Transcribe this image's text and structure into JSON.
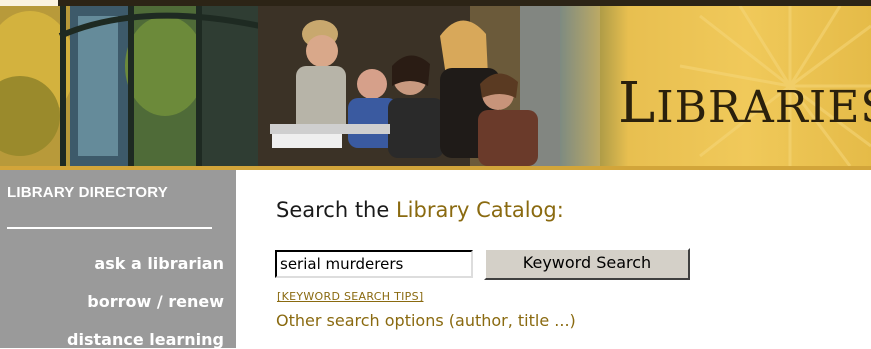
{
  "header": {
    "brand_first": "L",
    "brand_rest": "IBRARIES"
  },
  "sidebar": {
    "heading": "LIBRARY DIRECTORY",
    "links": [
      "ask a librarian",
      "borrow / renew",
      "distance learning"
    ]
  },
  "main": {
    "title_prefix": "Search the ",
    "title_accent": "Library Catalog:",
    "search_value": "serial murderers",
    "search_button": "Keyword Search",
    "tips_link": "[KEYWORD SEARCH TIPS]",
    "other_options": "Other search options (author, title ...)"
  },
  "colors": {
    "banner_gold": "#e3b84a",
    "sidebar_gray": "#9a9a9a",
    "link_brown": "#8a6a10"
  }
}
